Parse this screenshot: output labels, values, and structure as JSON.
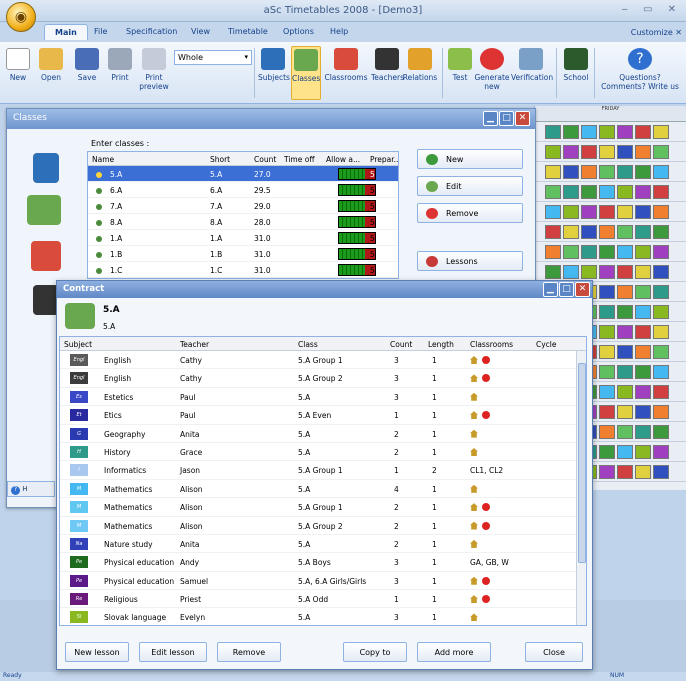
{
  "app": {
    "title": "aSc Timetables 2008 - [Demo3]",
    "customize": "Customize"
  },
  "tabs": [
    "Main",
    "File",
    "Specification",
    "View",
    "Timetable",
    "Options",
    "Help"
  ],
  "ribbon": {
    "buttons": [
      "New",
      "Open",
      "Save",
      "Print",
      "Print preview"
    ],
    "select_value": "Whole",
    "buttons2": [
      "Subjects",
      "Classes",
      "Classrooms",
      "Teachers",
      "Relations"
    ],
    "buttons3": [
      "Test",
      "Generate new",
      "Verification"
    ],
    "school": "School",
    "questions": "Questions? Comments? Write us"
  },
  "classes_window": {
    "title": "Classes",
    "enter_label": "Enter classes :",
    "columns": [
      "Name",
      "Short",
      "Count",
      "Time off",
      "Allow a...",
      "Prepar..."
    ],
    "rows": [
      {
        "name": "5.A",
        "short": "5.A",
        "count": "27.0",
        "prep": "5"
      },
      {
        "name": "6.A",
        "short": "6.A",
        "count": "29.5",
        "prep": "5"
      },
      {
        "name": "7.A",
        "short": "7.A",
        "count": "29.0",
        "prep": "5"
      },
      {
        "name": "8.A",
        "short": "8.A",
        "count": "28.0",
        "prep": "5"
      },
      {
        "name": "1.A",
        "short": "1.A",
        "count": "31.0",
        "prep": "5"
      },
      {
        "name": "1.B",
        "short": "1.B",
        "count": "31.0",
        "prep": "5"
      },
      {
        "name": "1.C",
        "short": "1.C",
        "count": "31.0",
        "prep": "5"
      }
    ],
    "buttons": [
      "New",
      "Edit",
      "Remove",
      "Lessons"
    ]
  },
  "grid": {
    "header": "FRIDAY"
  },
  "contract": {
    "title": "Contract",
    "class_name": "5.A",
    "class_short": "5.A",
    "columns": [
      "Subject",
      "Teacher",
      "Class",
      "Count",
      "Length",
      "Classrooms",
      "Cycle"
    ],
    "rows": [
      {
        "abbr": "Engl",
        "color": "#5a5a5a",
        "subject": "English",
        "teacher": "Cathy",
        "class": "5.A Group 1",
        "count": "3",
        "length": "1",
        "rooms": "",
        "no": true
      },
      {
        "abbr": "Engl",
        "color": "#3c3c3c",
        "subject": "English",
        "teacher": "Cathy",
        "class": "5.A Group 2",
        "count": "3",
        "length": "1",
        "rooms": "",
        "no": true
      },
      {
        "abbr": "Es",
        "color": "#3a48c8",
        "subject": "Estetics",
        "teacher": "Paul",
        "class": "5.A",
        "count": "3",
        "length": "1",
        "rooms": "",
        "no": false
      },
      {
        "abbr": "Et",
        "color": "#2a2aa0",
        "subject": "Etics",
        "teacher": "Paul",
        "class": "5.A Even",
        "count": "1",
        "length": "1",
        "rooms": "",
        "no": true
      },
      {
        "abbr": "G",
        "color": "#2a3ab0",
        "subject": "Geography",
        "teacher": "Anita",
        "class": "5.A",
        "count": "2",
        "length": "1",
        "rooms": "",
        "no": false
      },
      {
        "abbr": "H",
        "color": "#2e9a8a",
        "subject": "History",
        "teacher": "Grace",
        "class": "5.A",
        "count": "2",
        "length": "1",
        "rooms": "",
        "no": false
      },
      {
        "abbr": "I",
        "color": "#a8c8f0",
        "subject": "Informatics",
        "teacher": "Jason",
        "class": "5.A Group 1",
        "count": "1",
        "length": "2",
        "rooms": "CL1, CL2",
        "no": false
      },
      {
        "abbr": "M",
        "color": "#44b8f0",
        "subject": "Mathematics",
        "teacher": "Alison",
        "class": "5.A",
        "count": "4",
        "length": "1",
        "rooms": "",
        "no": false
      },
      {
        "abbr": "M",
        "color": "#60c8f0",
        "subject": "Mathematics",
        "teacher": "Alison",
        "class": "5.A Group 1",
        "count": "2",
        "length": "1",
        "rooms": "",
        "no": true
      },
      {
        "abbr": "M",
        "color": "#70c8f4",
        "subject": "Mathematics",
        "teacher": "Alison",
        "class": "5.A Group 2",
        "count": "2",
        "length": "1",
        "rooms": "",
        "no": true
      },
      {
        "abbr": "Na",
        "color": "#3040b8",
        "subject": "Nature study",
        "teacher": "Anita",
        "class": "5.A",
        "count": "2",
        "length": "1",
        "rooms": "",
        "no": false
      },
      {
        "abbr": "Pe",
        "color": "#1e6a1e",
        "subject": "Physical education",
        "teacher": "Andy",
        "class": "5.A Boys",
        "count": "3",
        "length": "1",
        "rooms": "GA, GB, W",
        "no": false
      },
      {
        "abbr": "Pe",
        "color": "#5a1a8a",
        "subject": "Physical education",
        "teacher": "Samuel",
        "class": "5.A, 6.A Girls/Girls",
        "count": "3",
        "length": "1",
        "rooms": "",
        "no": true
      },
      {
        "abbr": "Re",
        "color": "#6a1a7a",
        "subject": "Religious",
        "teacher": "Priest",
        "class": "5.A Odd",
        "count": "1",
        "length": "1",
        "rooms": "",
        "no": true
      },
      {
        "abbr": "Sl",
        "color": "#8ab820",
        "subject": "Slovak language",
        "teacher": "Evelyn",
        "class": "5.A",
        "count": "3",
        "length": "1",
        "rooms": "",
        "no": false
      }
    ],
    "buttons": [
      "New lesson",
      "Edit lesson",
      "Remove",
      "Copy to",
      "Add more",
      "Close"
    ]
  },
  "status": {
    "left": "Ready",
    "right": "NUM"
  }
}
